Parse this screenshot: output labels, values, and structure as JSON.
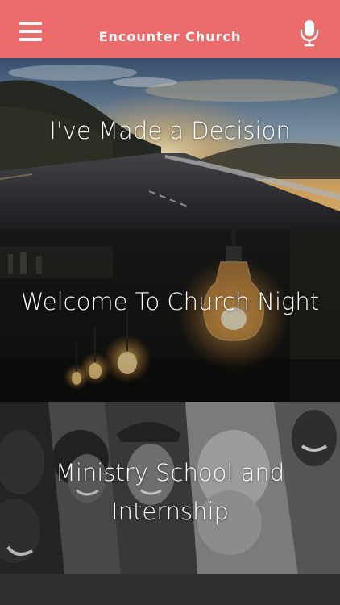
{
  "app": {
    "title": "Encounter Church"
  },
  "header": {
    "menu_icon": "hamburger-menu-icon",
    "mic_icon": "microphone-icon",
    "background_color": "#ec6b6b"
  },
  "tiles": [
    {
      "label": "I've Made a Decision"
    },
    {
      "label": "Welcome To Church Night"
    },
    {
      "label": "Ministry School and Internship"
    }
  ]
}
